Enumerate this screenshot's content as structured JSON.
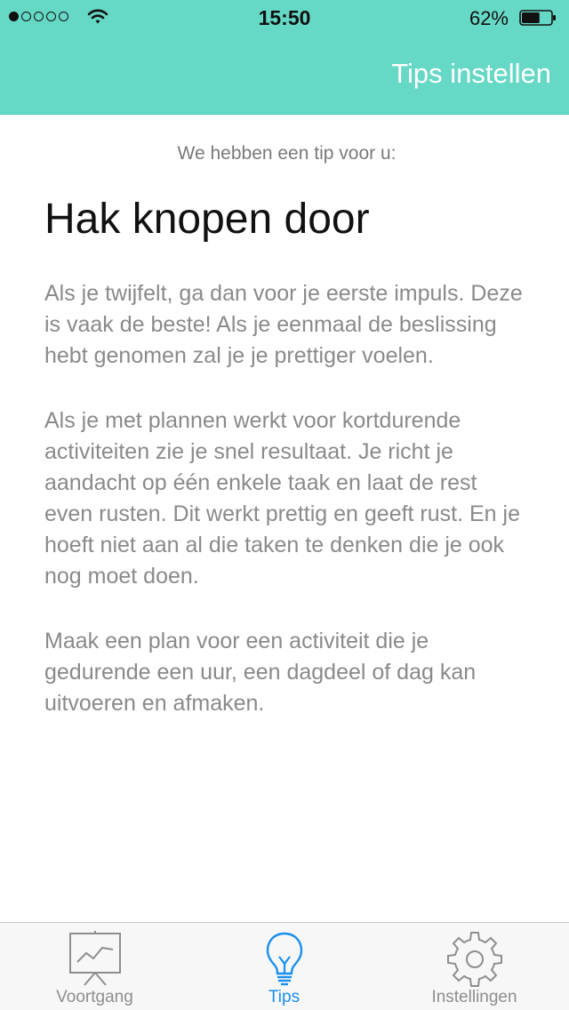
{
  "status": {
    "time": "15:50",
    "battery_percent": "62%",
    "signal_strength_dots": 1,
    "battery_level": 0.62
  },
  "header": {
    "action_label": "Tips instellen"
  },
  "content": {
    "intro": "We hebben een tip voor u:",
    "title": "Hak knopen door",
    "paragraphs": [
      "Als je twijfelt, ga dan voor je eerste impuls. Deze is vaak de beste! Als je eenmaal de beslissing hebt genomen zal je je prettiger voelen.",
      "Als je met plannen werkt voor kortdurende activiteiten zie je snel resultaat. Je richt je aandacht op één enkele taak en laat de rest even rusten. Dit werkt prettig en geeft rust. En je hoeft niet aan al die taken te denken die je ook nog moet doen.",
      "Maak een plan voor een activiteit die je gedurende een uur, een dagdeel of dag kan uitvoeren en afmaken."
    ]
  },
  "tabbar": {
    "items": [
      {
        "label": "Voortgang",
        "icon": "chart-board-icon",
        "active": false
      },
      {
        "label": "Tips",
        "icon": "lightbulb-icon",
        "active": true
      },
      {
        "label": "Instellingen",
        "icon": "gear-icon",
        "active": false
      }
    ]
  },
  "colors": {
    "header_bg": "#66d8c6",
    "accent": "#1a8ff0",
    "text_muted": "#8a8a8a"
  }
}
